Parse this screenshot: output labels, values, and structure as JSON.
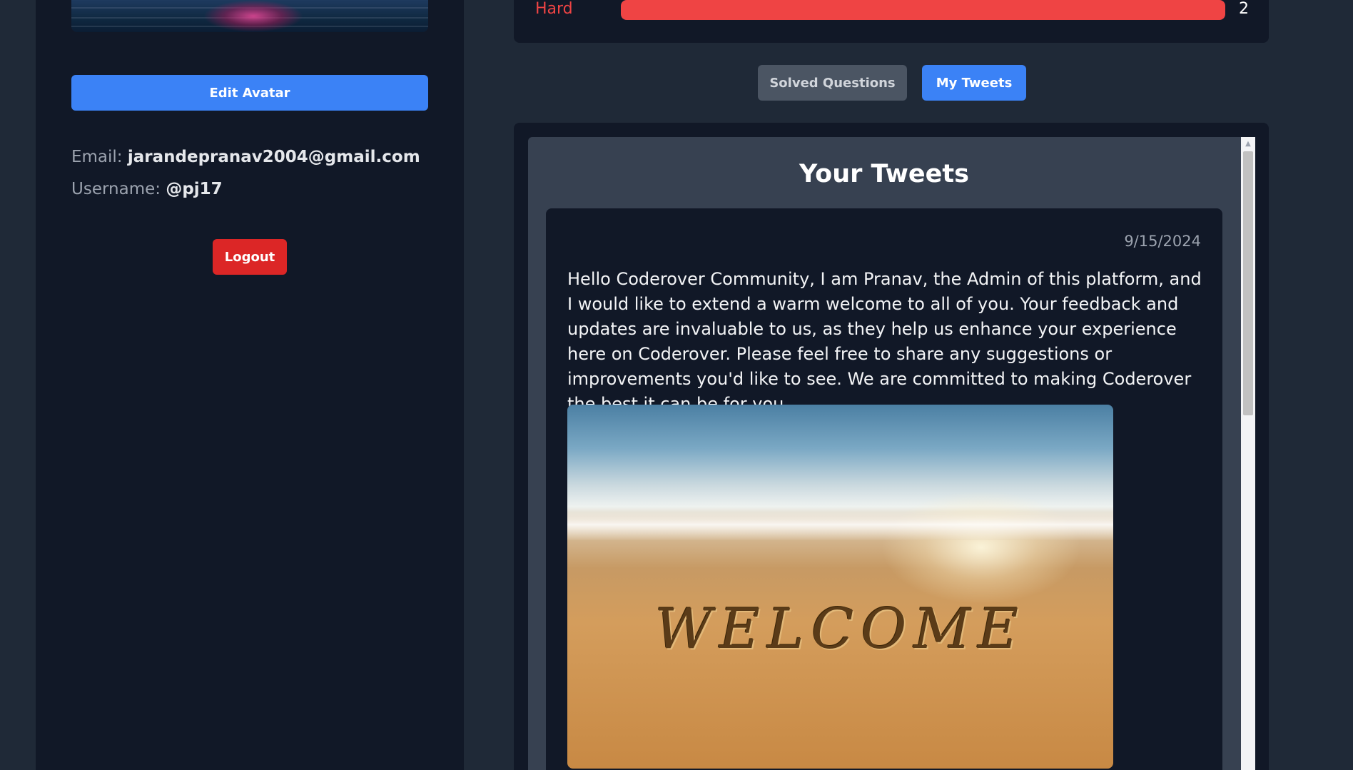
{
  "profile": {
    "edit_avatar_label": "Edit Avatar",
    "email_label": "Email:",
    "email_value": "jarandepranav2004@gmail.com",
    "username_label": "Username:",
    "username_value": "@pj17",
    "logout_label": "Logout"
  },
  "stats": {
    "hard_label": "Hard",
    "hard_count": "2",
    "hard_fill_fraction": 1.0,
    "hard_color": "#ef4444"
  },
  "tabs": {
    "solved_label": "Solved Questions",
    "tweets_label": "My Tweets",
    "active": "My Tweets"
  },
  "tweets": {
    "heading": "Your Tweets",
    "items": [
      {
        "date": "9/15/2024",
        "text": "Hello Coderover Community, I am Pranav, the Admin of this platform, and I would like to extend a warm welcome to all of you. Your feedback and updates are invaluable to us, as they help us enhance your experience here on Coderover. Please feel free to share any suggestions or improvements you'd like to see. We are committed to making Coderover the best it can be for you.",
        "image_caption": "WELCOME"
      }
    ]
  },
  "colors": {
    "page_bg": "#1f2937",
    "panel_bg": "#111827",
    "accent_blue": "#3b82f6",
    "danger_red": "#dc2626"
  }
}
